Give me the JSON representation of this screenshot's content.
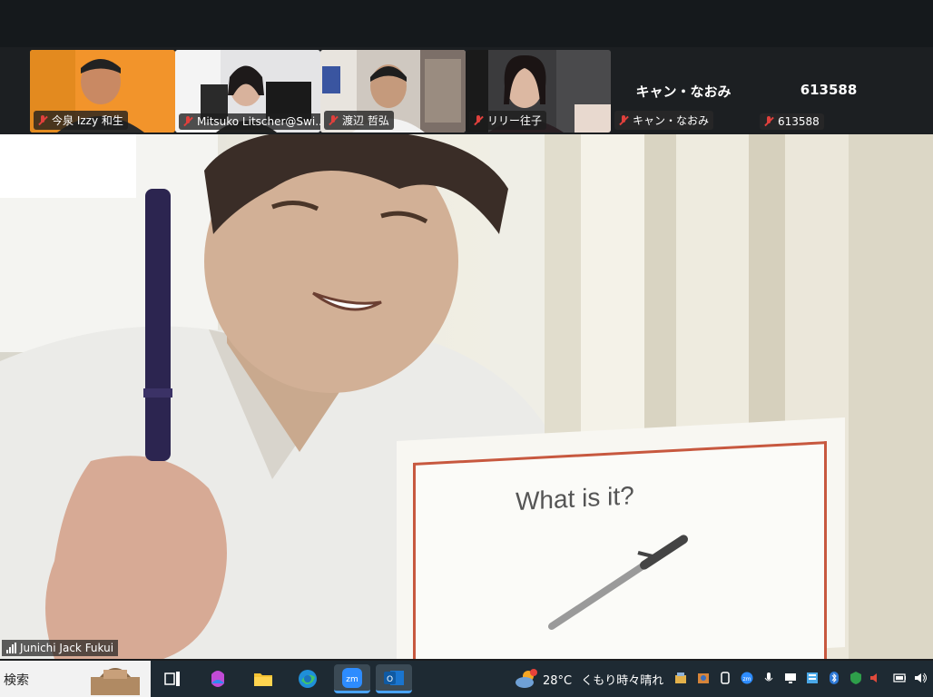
{
  "participants": [
    {
      "name": "今泉 Izzy 和生",
      "muted": true
    },
    {
      "name": "Mitsuko Litscher@Swi...",
      "muted": true
    },
    {
      "name": "渡辺 哲弘",
      "muted": true
    },
    {
      "name": "リリー往子",
      "muted": true
    },
    {
      "name": "キャン・なおみ",
      "display_name": "キャン・なおみ",
      "muted": true
    },
    {
      "name": "613588",
      "display_name": "613588",
      "muted": true
    }
  ],
  "speaker": {
    "name": "Junichi Jack Fukui"
  },
  "card": {
    "text": "What is it?"
  },
  "taskbar": {
    "search_label": "検索",
    "apps": [
      "task-view",
      "copilot",
      "file-explorer",
      "edge",
      "zoom",
      "outlook"
    ],
    "weather": {
      "temp": "28°C",
      "condition": "くもり時々晴れ"
    },
    "tray_icons": [
      "app-a",
      "app-b",
      "app-c",
      "zoom",
      "mic",
      "display",
      "network-panel",
      "bluetooth",
      "security",
      "volume-muted",
      "battery",
      "speaker"
    ]
  },
  "colors": {
    "zoom_blue": "#2d8cff",
    "muted_red": "#e0403c",
    "card_border": "#c7583f"
  }
}
